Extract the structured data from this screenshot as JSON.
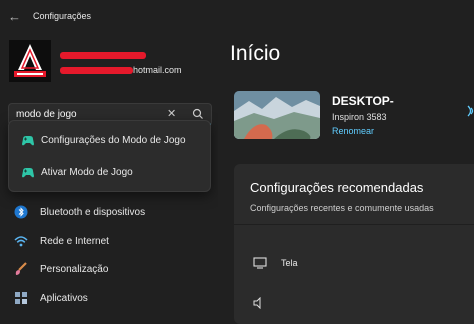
{
  "window": {
    "title": "Configurações",
    "back_icon": "arrow-left-icon"
  },
  "user": {
    "email_visible_suffix": "hotmail.com",
    "redaction_color": "#e5192b"
  },
  "search": {
    "value": "modo de jogo",
    "placeholder": "",
    "clear_icon": "close-icon",
    "search_icon": "search-icon"
  },
  "suggestions": [
    {
      "label": "Configurações do Modo de Jogo",
      "icon": "gamepad-icon"
    },
    {
      "label": "Ativar Modo de Jogo",
      "icon": "gamepad-icon"
    }
  ],
  "nav": {
    "items": [
      {
        "label": "Bluetooth e dispositivos",
        "icon": "bluetooth-icon"
      },
      {
        "label": "Rede e Internet",
        "icon": "wifi-icon"
      },
      {
        "label": "Personalização",
        "icon": "brush-icon"
      },
      {
        "label": "Aplicativos",
        "icon": "apps-icon"
      }
    ]
  },
  "main": {
    "title": "Início",
    "device": {
      "name": "DESKTOP-",
      "model": "Inspiron 3583",
      "rename": "Renomear"
    },
    "recommended": {
      "title": "Configurações recomendadas",
      "subtitle": "Configurações recentes e comumente usadas",
      "rows": [
        {
          "label": "Tela",
          "icon": "monitor-icon"
        }
      ]
    }
  },
  "colors": {
    "accent": "#60cdff",
    "background": "#202020",
    "card": "#2b2b2b"
  }
}
